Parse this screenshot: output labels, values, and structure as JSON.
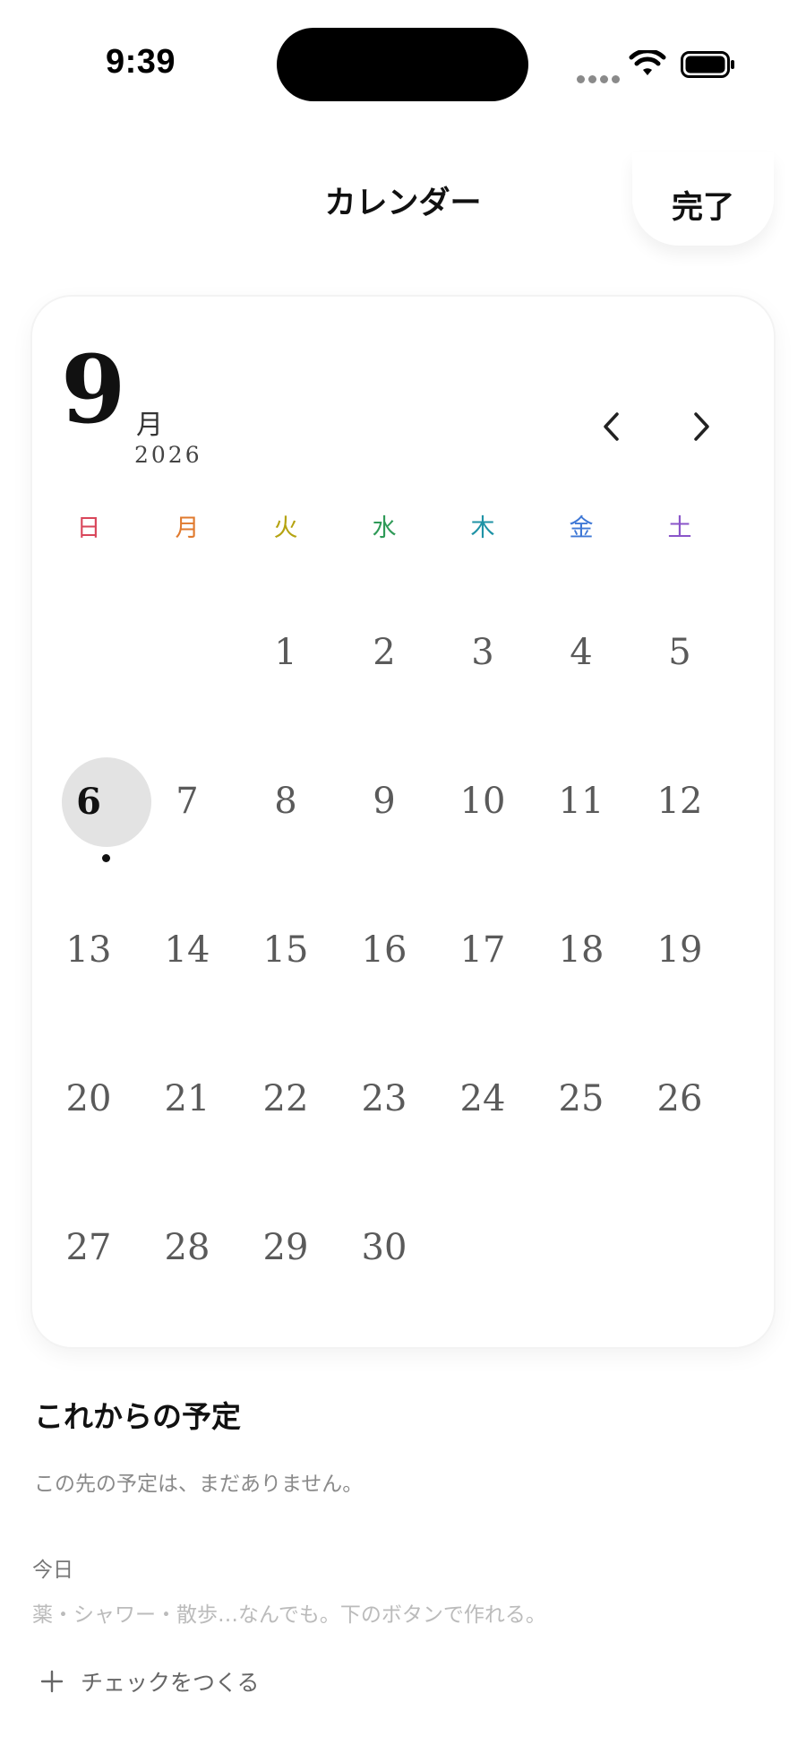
{
  "status_bar": {
    "time": "9:39",
    "icons": [
      "cellular-dots-icon",
      "wifi-icon",
      "battery-icon"
    ]
  },
  "header": {
    "title": "カレンダー",
    "done_label": "完了"
  },
  "calendar": {
    "month": "9",
    "month_suffix": "月",
    "year": "2026",
    "prev_icon": "chevron-left-icon",
    "next_icon": "chevron-right-icon",
    "weekdays": [
      {
        "label": "日",
        "color": "#d9465a"
      },
      {
        "label": "月",
        "color": "#e07a2e"
      },
      {
        "label": "火",
        "color": "#b5a311"
      },
      {
        "label": "水",
        "color": "#2e9a57"
      },
      {
        "label": "木",
        "color": "#1f93a6"
      },
      {
        "label": "金",
        "color": "#3f78d6"
      },
      {
        "label": "土",
        "color": "#8a55c9"
      }
    ],
    "first_weekday_index": 2,
    "days": [
      "1",
      "2",
      "3",
      "4",
      "5",
      "6",
      "7",
      "8",
      "9",
      "10",
      "11",
      "12",
      "13",
      "14",
      "15",
      "16",
      "17",
      "18",
      "19",
      "20",
      "21",
      "22",
      "23",
      "24",
      "25",
      "26",
      "27",
      "28",
      "29",
      "30"
    ],
    "today": "6",
    "days_with_events": [
      "6"
    ]
  },
  "upcoming": {
    "title": "これからの予定",
    "empty_message": "この先の予定は、まだありません。"
  },
  "today_section": {
    "label": "今日",
    "hint": "薬・シャワー・散歩…なんでも。下のボタンで作れる。",
    "create_label": "チェックをつくる",
    "create_icon": "plus-icon"
  }
}
